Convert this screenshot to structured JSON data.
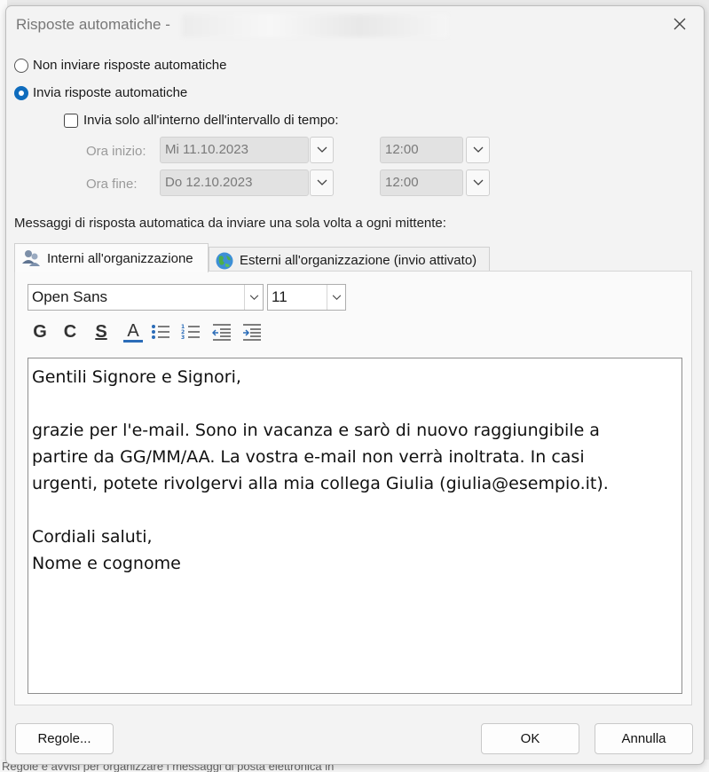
{
  "dialog": {
    "title": "Risposte automatiche -",
    "close_icon": "close-icon"
  },
  "options": {
    "no_reply_label": "Non inviare risposte automatiche",
    "no_reply_selected": false,
    "send_reply_label": "Invia risposte automatiche",
    "send_reply_selected": true,
    "time_range_label": "Invia solo all'interno dell'intervallo di tempo:",
    "time_range_checked": false
  },
  "schedule": {
    "start_label": "Ora inizio:",
    "start_date": "Mi 11.10.2023",
    "start_time": "12:00",
    "end_label": "Ora fine:",
    "end_date": "Do 12.10.2023",
    "end_time": "12:00"
  },
  "message_label": "Messaggi di risposta automatica da inviare una sola volta a ogni mittente:",
  "tabs": [
    {
      "label": "Interni all'organizzazione",
      "icon": "people-icon",
      "active": true
    },
    {
      "label": "Esterni all'organizzazione (invio attivato)",
      "icon": "globe-icon",
      "active": false
    }
  ],
  "toolbar": {
    "font": "Open Sans",
    "size": "11",
    "bold": "G",
    "italic": "C",
    "underline": "S",
    "font_color": "A",
    "font_color_hex": "#2b6cb8"
  },
  "editor": {
    "lines": [
      "Gentili Signore e Signori,",
      "",
      "grazie per l'e-mail. Sono in vacanza e sarò di nuovo raggiungibile a",
      "partire da GG/MM/AA. La vostra e-mail non verrà inoltrata. In casi",
      "urgenti, potete rivolgervi alla mia collega Giulia (giulia@esempio.it).",
      "",
      "Cordiali saluti,",
      "Nome e cognome"
    ]
  },
  "buttons": {
    "rules": "Regole...",
    "ok": "OK",
    "cancel": "Annulla"
  },
  "background": {
    "bottom_text": "Regole e avvisi per organizzare i messaggi di posta elettronica in"
  }
}
